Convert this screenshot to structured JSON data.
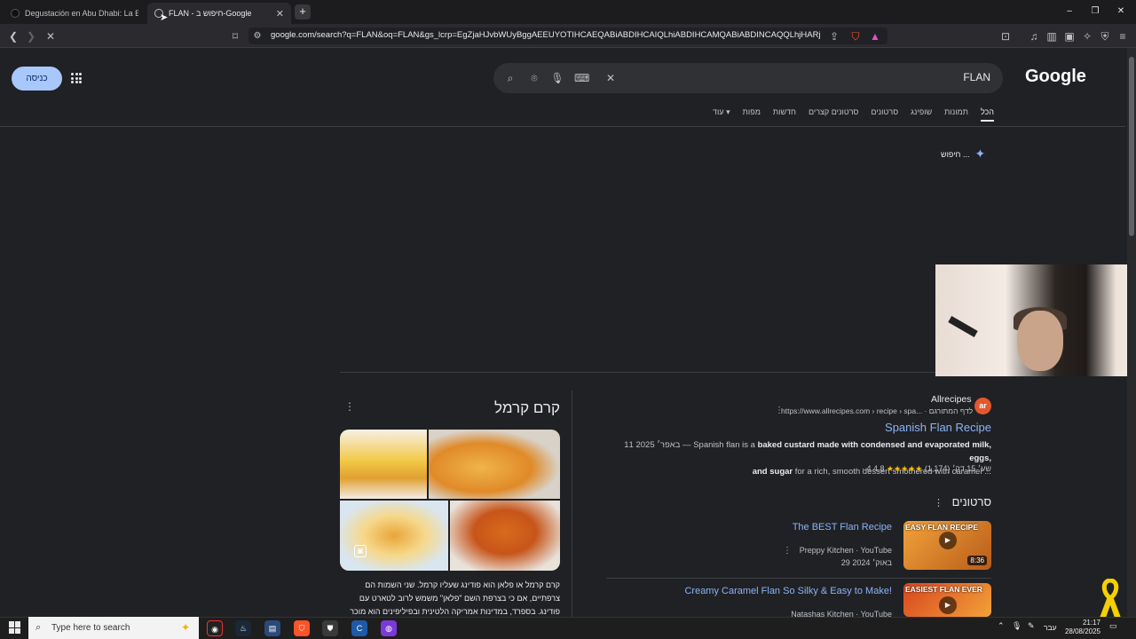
{
  "browser": {
    "tabs": [
      {
        "title": "Degustación en Abu Dhabi: La Experi",
        "active": false
      },
      {
        "title": "FLAN - חיפוש ב-Google",
        "active": true
      }
    ],
    "new_tab_label": "+",
    "url": "google.com/search?q=FLAN&oq=FLAN&gs_lcrp=EgZjaHJvbWUyBggAEEUYOTIHCAEQABiABDIHCAIQLhiABDIHCAMQABiABDINCAQQLhjHARjRAxiAB...",
    "window_controls": {
      "minimize": "–",
      "restore": "❐",
      "close": "✕"
    }
  },
  "google": {
    "logo": "Google",
    "signin_label": "כניסה",
    "query": "FLAN",
    "nav_tabs": [
      "הכל",
      "תמונות",
      "שופינג",
      "סרטונים",
      "סרטונים קצרים",
      "חדשות",
      "מפות",
      "עוד"
    ],
    "ai_mode_label": "חיפוש ..."
  },
  "knowledge_panel": {
    "title": "קרם קרמל",
    "description": "קרם קרמל או פלאן הוא פודינג שעליו קרמל. שני השמות הם צרפתיים, אם כי בצרפת השם \"פלאן\" משמש לרוב לטארט עם פודינג. בספרד, במדינות אמריקה הלטינית ובפיליפינים הוא מוכר כ\"פלאן\" וכך"
  },
  "result": {
    "site_name": "Allrecipes",
    "logo_text": "ar",
    "breadcrumb": "https://www.allrecipes.com › recipe › spa... · לדף המתורגם",
    "title": "Spanish Flan Recipe",
    "date": "11 באפר׳ 2025 —",
    "snippet_pre": "Spanish flan is a ",
    "snippet_bold1": "baked custard made with condensed and evaporated milk, eggs,",
    "snippet_bold2": "and sugar",
    "snippet_post": " for a rich, smooth dessert smothered with caramel ...",
    "rating_value": "4.8",
    "stars": "★★★★★",
    "rating_count": "(1,174)",
    "time": "· 4 שע׳ 15 דק׳"
  },
  "videos": {
    "heading": "סרטונים",
    "items": [
      {
        "title": "The BEST Flan Recipe",
        "channel": "Preppy Kitchen · YouTube",
        "date": "29 באוק׳ 2024",
        "thumb_caption": "EASY FLAN RECIPE",
        "duration": "8:36"
      },
      {
        "title": "Creamy Caramel Flan So Silky & Easy to Make!",
        "channel": "Natashas Kitchen · YouTube",
        "date": "",
        "thumb_caption": "EASIEST FLAN EVER",
        "duration": ""
      }
    ]
  },
  "taskbar": {
    "search_placeholder": "Type here to search",
    "language": "עבר",
    "time": "21:17",
    "date": "28/08/2025"
  },
  "colors": {
    "background": "#202124",
    "link": "#8ab4f8",
    "signin_button": "#a8c7fa",
    "stars": "#fbbc04",
    "ribbon": "#f5d000"
  }
}
